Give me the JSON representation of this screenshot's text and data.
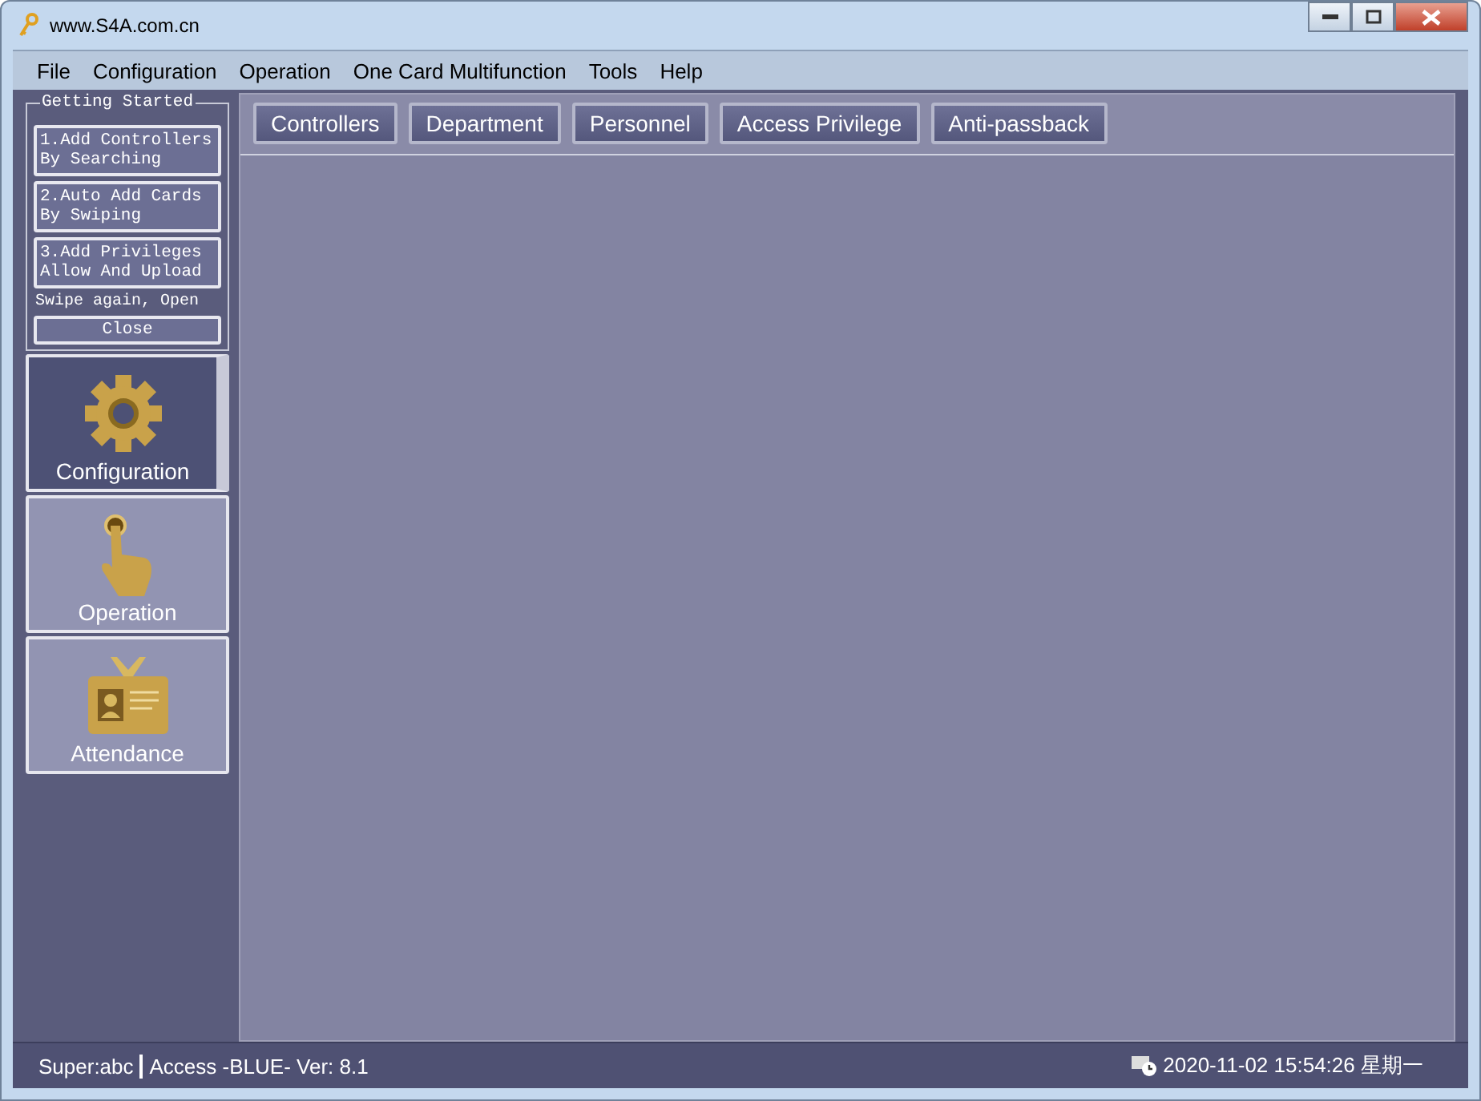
{
  "window": {
    "title": "www.S4A.com.cn"
  },
  "menu": [
    "File",
    "Configuration",
    "Operation",
    "One Card Multifunction",
    "Tools",
    "Help"
  ],
  "getting_started": {
    "title": "Getting Started",
    "steps": [
      "1.Add Controllers\nBy Searching",
      "2.Auto Add Cards\nBy Swiping",
      "3.Add Privileges\nAllow And Upload"
    ],
    "note": "Swipe again, Open",
    "close": "Close"
  },
  "sidebar": {
    "items": [
      {
        "kind": "gear",
        "label": "Configuration",
        "selected": true
      },
      {
        "kind": "hand",
        "label": "Operation",
        "selected": false
      },
      {
        "kind": "badge",
        "label": "Attendance",
        "selected": false
      }
    ]
  },
  "tabs": [
    "Controllers",
    "Department",
    "Personnel",
    "Access Privilege",
    "Anti-passback"
  ],
  "status_bar": {
    "user": "Super:abc",
    "version": "Access -BLUE- Ver: 8.1",
    "datetime": "2020-11-02 15:54:26 星期一"
  }
}
